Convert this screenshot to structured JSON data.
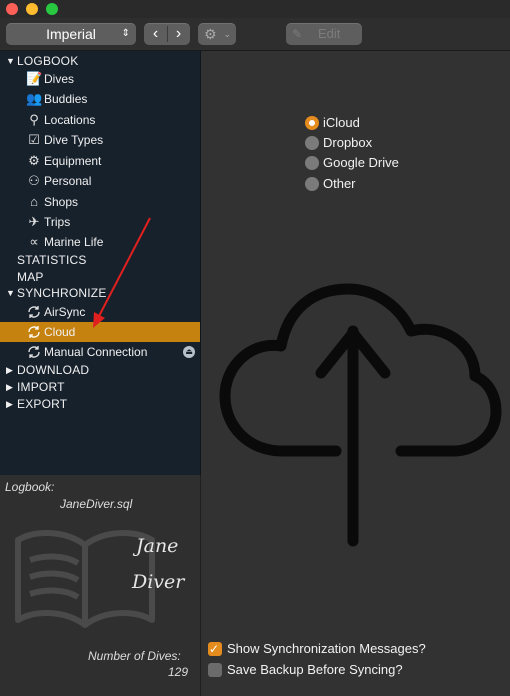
{
  "toolbar": {
    "unit_select": "Imperial",
    "back_glyph": "‹",
    "forward_glyph": "›",
    "gear_glyph": "⚙",
    "edit_label": "Edit"
  },
  "sidebar": {
    "logbook_header": "LOGBOOK",
    "items": [
      {
        "label": "Dives",
        "icon": "book-icon"
      },
      {
        "label": "Buddies",
        "icon": "people-icon"
      },
      {
        "label": "Locations",
        "icon": "pin-icon"
      },
      {
        "label": "Dive Types",
        "icon": "checklist-icon"
      },
      {
        "label": "Equipment",
        "icon": "gear-icon"
      },
      {
        "label": "Personal",
        "icon": "person-icon"
      },
      {
        "label": "Shops",
        "icon": "house-icon"
      },
      {
        "label": "Trips",
        "icon": "airplane-icon"
      },
      {
        "label": "Marine Life",
        "icon": "fish-icon"
      }
    ],
    "statistics": "STATISTICS",
    "map": "MAP",
    "synchronize_header": "SYNCHRONIZE",
    "sync_items": [
      "AirSync",
      "Cloud",
      "Manual Connection"
    ],
    "download": "DOWNLOAD",
    "import": "IMPORT",
    "export": "EXPORT"
  },
  "logbook_panel": {
    "label": "Logbook:",
    "filename": "JaneDiver.sql",
    "brand_line1": "Jane",
    "brand_line2": "Diver",
    "dives_label": "Number of Dives:",
    "dives_count": "129"
  },
  "sync_options": {
    "providers": [
      "iCloud",
      "Dropbox",
      "Google Drive",
      "Other"
    ],
    "selected": "iCloud",
    "show_messages_label": "Show Synchronization Messages?",
    "show_messages_checked": true,
    "save_backup_label": "Save Backup Before Syncing?",
    "save_backup_checked": false
  },
  "colors": {
    "accent": "#e58c1e",
    "selection": "#c6820f",
    "annotation_arrow": "#e0201e"
  }
}
